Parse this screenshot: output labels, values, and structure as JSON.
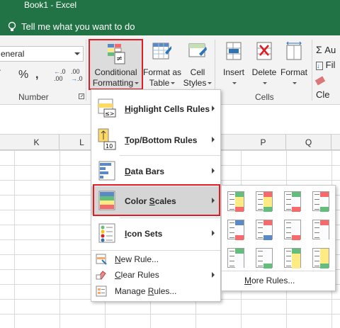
{
  "window": {
    "title": "Book1  -  Excel"
  },
  "tell_me": {
    "text": "Tell me what you want to do"
  },
  "number_group": {
    "format_value": "eneral",
    "percent": "%",
    "comma": ",",
    "increase_decimal": "←.0 .00",
    "decrease_decimal": ".00 →.0",
    "label": "Number"
  },
  "styles_group": {
    "conditional_formatting": {
      "line1": "Conditional",
      "line2": "Formatting"
    },
    "format_as_table": {
      "line1": "Format as",
      "line2": "Table"
    },
    "cell_styles": {
      "line1": "Cell",
      "line2": "Styles"
    }
  },
  "cells_group": {
    "insert": "Insert",
    "delete": "Delete",
    "format": "Format",
    "label": "Cells"
  },
  "editing_group": {
    "autosum": "Au",
    "fill": "Fil",
    "clear": "Cle"
  },
  "columns": [
    "K",
    "L",
    "P",
    "Q"
  ],
  "menu": {
    "highlight": "Highlight Cells Rules",
    "topbottom": "Top/Bottom Rules",
    "databars": "Data Bars",
    "colorscales": "Color Scales",
    "iconsets": "Icon Sets",
    "newrule": "New Rule...",
    "clearrules": "Clear Rules",
    "managerules": "Manage Rules..."
  },
  "submenu": {
    "more_rules": "More Rules..."
  },
  "colors": {
    "accent": "#217346",
    "highlight_border": "#e31b23",
    "green": "#63be7b",
    "yellow": "#ffeb84",
    "red": "#f8696b",
    "blue": "#5a8ac6",
    "white": "#fcfcff"
  }
}
